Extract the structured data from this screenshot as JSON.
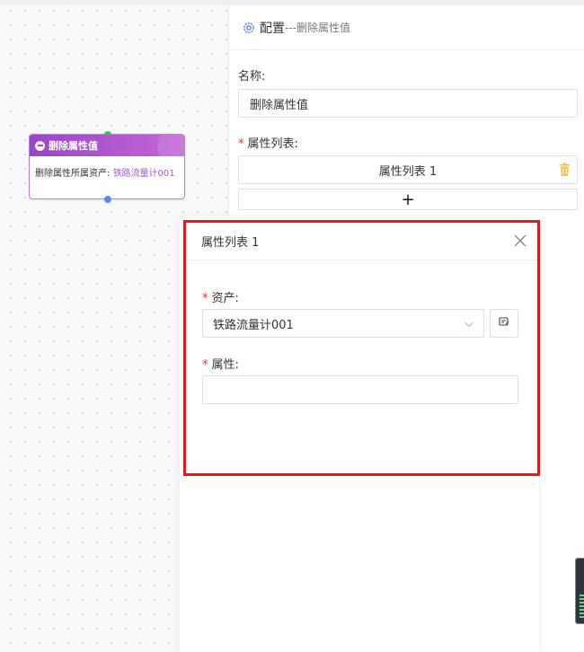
{
  "node": {
    "title": "删除属性值",
    "body_label": "删除属性所属资产: ",
    "body_value": "铁路流量计001"
  },
  "panel": {
    "title": "配置",
    "subtitle": "---删除属性值",
    "name_label": "名称:",
    "name_value": "删除属性值",
    "list_label": "属性列表:",
    "list_item_label": "属性列表 1",
    "add_label": "+"
  },
  "dialog": {
    "title": "属性列表 1",
    "asset_label": "资产:",
    "asset_value": "铁路流量计001",
    "property_label": "属性:",
    "property_value": ""
  },
  "colors": {
    "accent_purple": "#a64ccb",
    "required_red": "#e5312f",
    "highlight_border": "#e4181b",
    "trash_yellow": "#f4c542",
    "gear_blue": "#4a7bd8"
  },
  "icons": [
    "minus-icon",
    "gear-icon",
    "trash-icon",
    "close-icon",
    "chevron-down-icon",
    "edit-icon"
  ]
}
